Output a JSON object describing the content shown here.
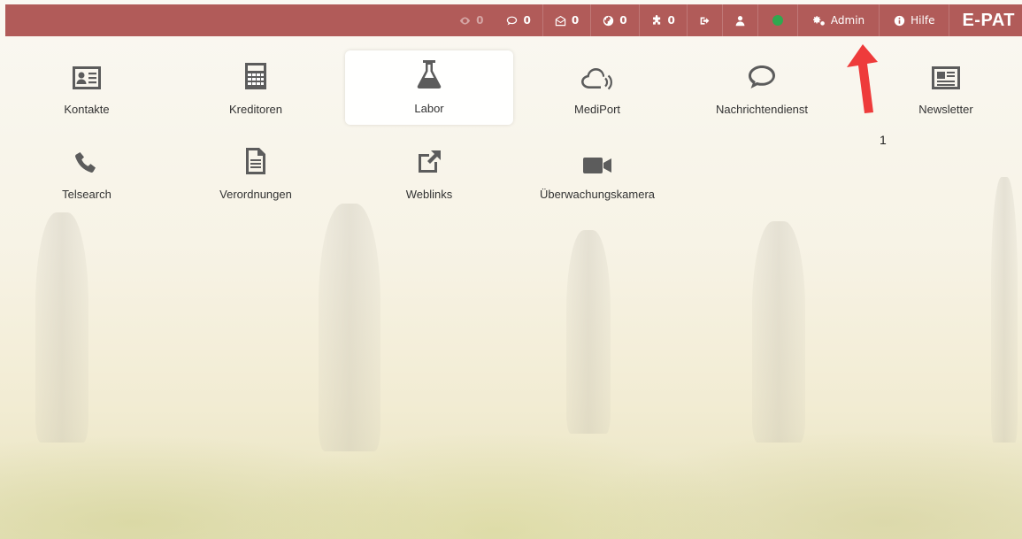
{
  "topbar": {
    "items": [
      {
        "icon": "eye-icon",
        "count": "0",
        "dim": true
      },
      {
        "icon": "chat-bubble-icon",
        "count": "0"
      },
      {
        "icon": "envelope-open-icon",
        "count": "0"
      },
      {
        "icon": "globe-icon",
        "count": "0"
      },
      {
        "icon": "puzzle-icon",
        "count": "0"
      },
      {
        "icon": "sign-out-icon",
        "count": ""
      },
      {
        "icon": "user-icon",
        "count": ""
      },
      {
        "icon": "status-dot-icon",
        "count": ""
      }
    ],
    "admin_label": "Admin",
    "help_label": "Hilfe",
    "brand": "E-PAT",
    "bar_color": "#b15b59",
    "status_color": "#2fa84f"
  },
  "tiles": {
    "kontakte": "Kontakte",
    "kreditoren": "Kreditoren",
    "labor": "Labor",
    "mediport": "MediPort",
    "nachrichtendienst": "Nachrichtendienst",
    "newsletter": "Newsletter",
    "telsearch": "Telsearch",
    "verordnungen": "Verordnungen",
    "weblinks": "Weblinks",
    "ueberwachungskamera": "Überwachungskamera"
  },
  "annotation": {
    "marker": "1",
    "arrow_color": "#ee3b3b"
  }
}
